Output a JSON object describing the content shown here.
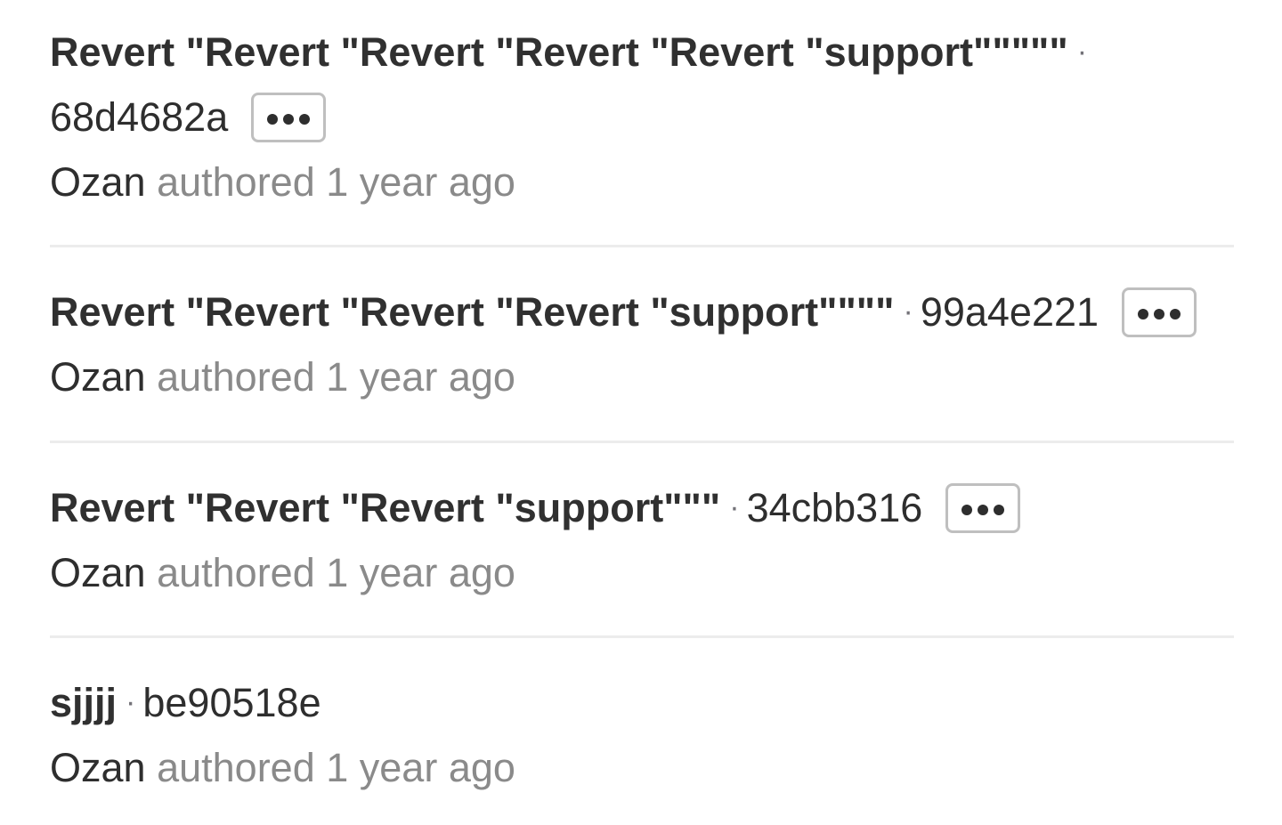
{
  "commits": [
    {
      "title": "Revert \"Revert \"Revert \"Revert \"Revert \"support\"\"\"\"\"",
      "separator": "·",
      "sha": "68d4682a",
      "author": "Ozan",
      "authored_label": "authored",
      "time": "1 year ago",
      "has_more_button": true
    },
    {
      "title": "Revert \"Revert \"Revert \"Revert \"support\"\"\"\"",
      "separator": "·",
      "sha": "99a4e221",
      "author": "Ozan",
      "authored_label": "authored",
      "time": "1 year ago",
      "has_more_button": true
    },
    {
      "title": "Revert \"Revert \"Revert \"support\"\"\"",
      "separator": "·",
      "sha": "34cbb316",
      "author": "Ozan",
      "authored_label": "authored",
      "time": "1 year ago",
      "has_more_button": true
    },
    {
      "title": "sjjjj",
      "separator": "·",
      "sha": "be90518e",
      "author": "Ozan",
      "authored_label": "authored",
      "time": "1 year ago",
      "has_more_button": false
    }
  ],
  "icons": {
    "more": "ellipsis-icon"
  },
  "colors": {
    "title": "#303030",
    "muted": "#8a8a8a",
    "divider": "#ececec",
    "button_border": "#bfbfbf"
  }
}
